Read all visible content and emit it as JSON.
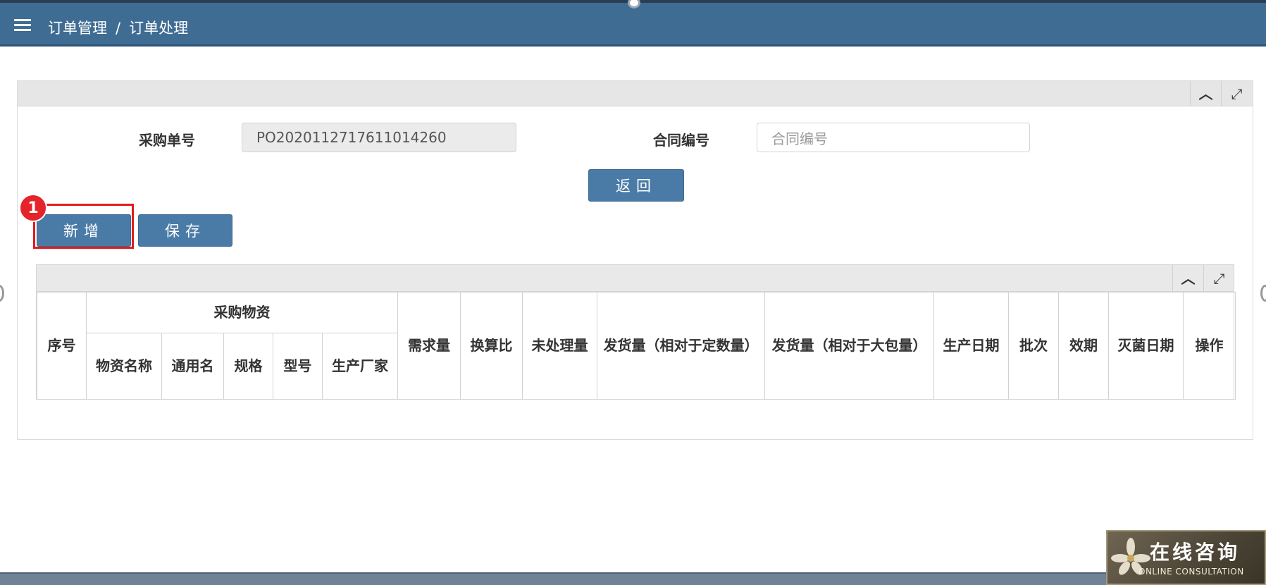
{
  "header": {
    "breadcrumb": [
      "订单管理",
      "订单处理"
    ],
    "separator": "/"
  },
  "form": {
    "po_label": "采购单号",
    "po_value": "PO2020112717611014260",
    "contract_label": "合同编号",
    "contract_placeholder": "合同编号"
  },
  "buttons": {
    "back": "返回",
    "add": "新增",
    "save": "保存"
  },
  "annotation": {
    "step_number": "1"
  },
  "table": {
    "group_header": "采购物资",
    "columns": {
      "seq": "序号",
      "material_name": "物资名称",
      "common_name": "通用名",
      "spec": "规格",
      "model": "型号",
      "manufacturer": "生产厂家",
      "demand_qty": "需求量",
      "conversion": "换算比",
      "unprocessed": "未处理量",
      "ship_qty_fixed": "发货量（相对于定数量）",
      "ship_qty_pack": "发货量（相对于大包量）",
      "prod_date": "生产日期",
      "batch": "批次",
      "expiry": "效期",
      "sterile_date": "灭菌日期",
      "action": "操作"
    }
  },
  "consult_widget": {
    "title": "在线咨询",
    "subtitle": "ONLINE CONSULTATION"
  },
  "icons": {
    "menu": "hamburger-icon",
    "collapse": "chevron-up-icon",
    "expand": "expand-icon"
  },
  "colors": {
    "header_bg": "#3f6c93",
    "button_bg": "#4a7ba7",
    "highlight": "#e11b1b"
  }
}
